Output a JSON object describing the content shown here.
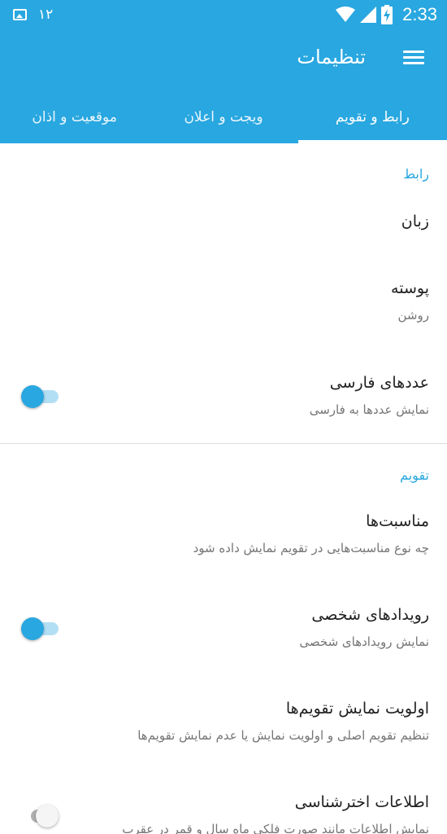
{
  "status_bar": {
    "notification_count": "۱۲",
    "time": "2:33"
  },
  "app_bar": {
    "title": "تنظیمات"
  },
  "tabs": [
    {
      "label": "رابط و تقویم",
      "active": true
    },
    {
      "label": "ویجت و اعلان",
      "active": false
    },
    {
      "label": "موقعیت و اذان",
      "active": false
    }
  ],
  "sections": {
    "interface": {
      "header": "رابط",
      "language": {
        "title": "زبان"
      },
      "theme": {
        "title": "پوسته",
        "summary": "روشن"
      },
      "persian_digits": {
        "title": "عددهای فارسی",
        "summary": "نمایش عددها به فارسی",
        "enabled": true
      }
    },
    "calendar": {
      "header": "تقویم",
      "holidays": {
        "title": "مناسبت‌ها",
        "summary": "چه نوع مناسبت‌هایی در تقویم نمایش داده شود"
      },
      "personal_events": {
        "title": "رویدادهای شخصی",
        "summary": "نمایش رویدادهای شخصی",
        "enabled": true
      },
      "calendar_priority": {
        "title": "اولویت نمایش تقویم‌ها",
        "summary": "تنظیم تقویم اصلی و اولویت نمایش یا عدم نمایش تقویم‌ها"
      },
      "astronomy": {
        "title": "اطلاعات اخترشناسی",
        "summary": "نمایش اطلاعات مانند صورت فلکی ماه سال و قمر در عقرب",
        "enabled": false
      }
    }
  },
  "colors": {
    "primary": "#29a7e0",
    "text_primary": "#212121",
    "text_secondary": "#757575"
  }
}
